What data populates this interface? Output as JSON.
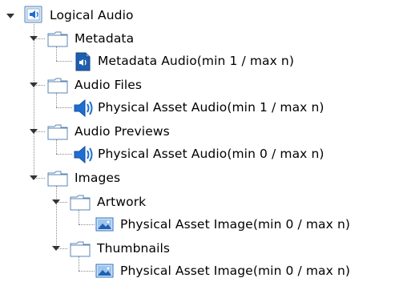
{
  "tree": {
    "root": {
      "label": "Logical Audio"
    },
    "nodes": {
      "metadata": {
        "label": "Metadata",
        "child": "Metadata Audio(min 1 / max n)"
      },
      "audio_files": {
        "label": "Audio Files",
        "child": "Physical Asset Audio(min 1 / max n)"
      },
      "audio_previews": {
        "label": "Audio Previews",
        "child": "Physical Asset Audio(min 0 / max n)"
      },
      "images": {
        "label": "Images",
        "artwork": {
          "label": "Artwork",
          "child": "Physical Asset Image(min 0 / max n)"
        },
        "thumbnails": {
          "label": "Thumbnails",
          "child": "Physical Asset Image(min 0 / max n)"
        }
      }
    }
  },
  "colors": {
    "folder_stroke": "#5a86b6",
    "folder_fill": "#ffffff",
    "audio_icon_blue": "#1f6fd1",
    "connector": "#8a8a8a"
  }
}
